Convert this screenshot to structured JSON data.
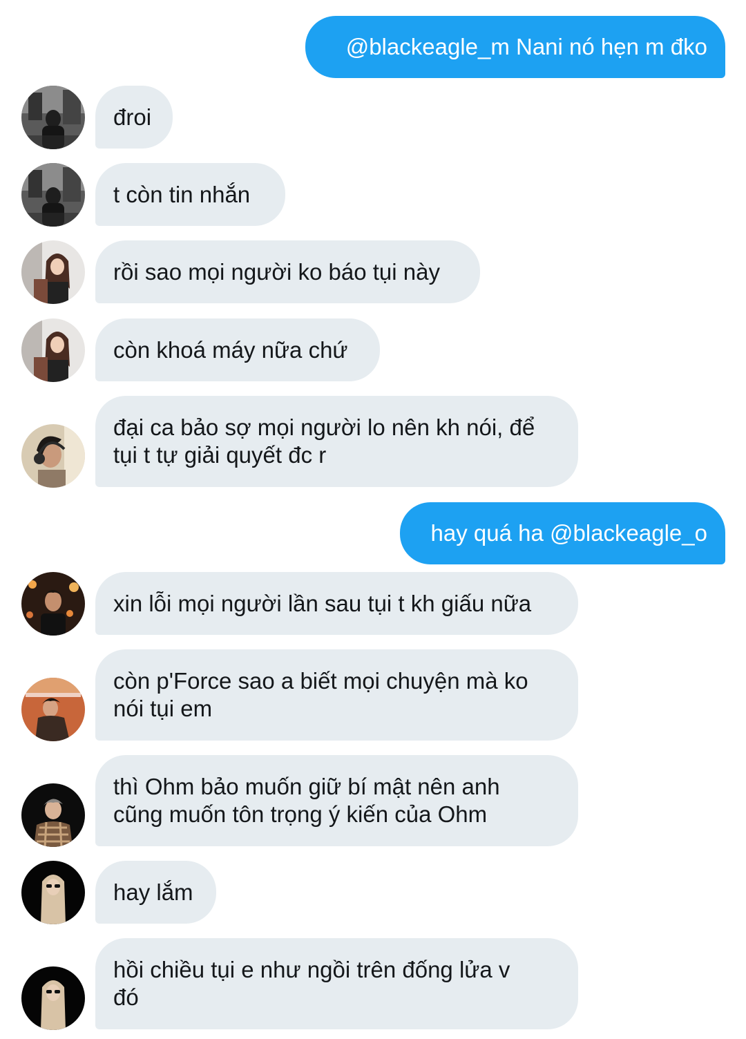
{
  "messages": [
    {
      "id": "m1",
      "direction": "outgoing",
      "text": "@blackeagle_m Nani nó hẹn m đko"
    },
    {
      "id": "m2",
      "direction": "incoming",
      "sender_avatar": "avatar-street-bw",
      "text": "đroi"
    },
    {
      "id": "m3",
      "direction": "incoming",
      "sender_avatar": "avatar-street-bw",
      "text": "t còn tin nhắn"
    },
    {
      "id": "m4",
      "direction": "incoming",
      "sender_avatar": "avatar-girl-mirror",
      "text": "rồi sao mọi người ko báo tụi này"
    },
    {
      "id": "m5",
      "direction": "incoming",
      "sender_avatar": "avatar-girl-mirror",
      "text": "còn khoá máy nữa chứ"
    },
    {
      "id": "m6",
      "direction": "incoming",
      "sender_avatar": "avatar-headphones",
      "text": "đại ca bảo sợ mọi người lo nên kh nói, để\ntụi t tự giải quyết đc r"
    },
    {
      "id": "m7",
      "direction": "outgoing",
      "text": "hay quá ha @blackeagle_o"
    },
    {
      "id": "m8",
      "direction": "incoming",
      "sender_avatar": "avatar-night-lights",
      "text": "xin lỗi mọi người lần sau tụi t kh giấu nữa"
    },
    {
      "id": "m9",
      "direction": "incoming",
      "sender_avatar": "avatar-orange-jacket",
      "text": "còn p'Force sao a biết mọi chuyện mà ko\nnói tụi em"
    },
    {
      "id": "m10",
      "direction": "incoming",
      "sender_avatar": "avatar-plaid-shirt",
      "text": "thì Ohm bảo muốn giữ bí mật nên anh\ncũng muốn tôn trọng ý kiến của Ohm"
    },
    {
      "id": "m11",
      "direction": "incoming",
      "sender_avatar": "avatar-sunglasses",
      "text": "hay lắm"
    },
    {
      "id": "m12",
      "direction": "incoming",
      "sender_avatar": "avatar-sunglasses",
      "text": "hồi chiều tụi e như ngồi trên đống lửa v\nđó"
    }
  ],
  "colors": {
    "outgoing_bubble": "#1da1f2",
    "incoming_bubble": "#e6ecf0",
    "incoming_text": "#14171a",
    "outgoing_text": "#ffffff"
  }
}
